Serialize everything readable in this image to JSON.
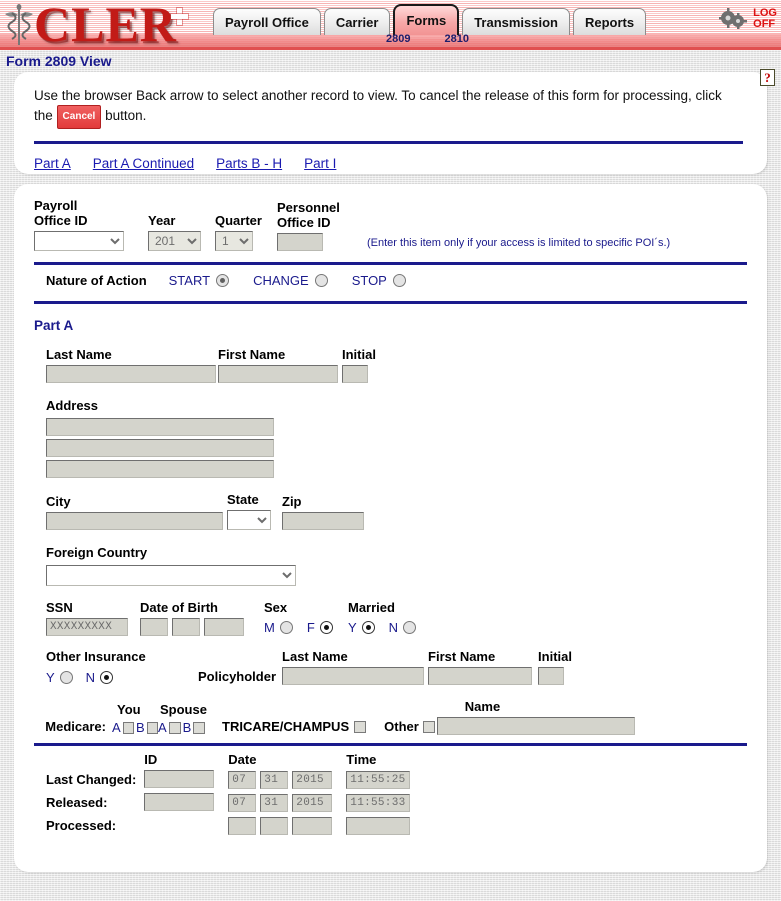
{
  "banner": {
    "logo_text": "CLER",
    "caduceus_icon": "caduceus-icon",
    "tabs": [
      {
        "label": "Payroll Office",
        "active": false
      },
      {
        "label": "Carrier",
        "active": false
      },
      {
        "label": "Forms",
        "active": true
      },
      {
        "label": "Transmission",
        "active": false
      },
      {
        "label": "Reports",
        "active": false
      }
    ],
    "subtabs": [
      {
        "label": "2809"
      },
      {
        "label": "2810"
      }
    ],
    "gears_icon": "gears-icon",
    "logoff_line1": "LOG",
    "logoff_line2": "OFF"
  },
  "page_title": "Form 2809 View",
  "instructions": {
    "help_icon": "help-question-icon",
    "text_before": "Use the browser Back arrow to select another record to view.  To cancel the release of this form for processing, click the",
    "cancel_label": "Cancel",
    "text_after": "button.",
    "part_links": [
      {
        "label": "Part A"
      },
      {
        "label": "Part A Continued"
      },
      {
        "label": "Parts B - H"
      },
      {
        "label": "Part I"
      }
    ]
  },
  "form": {
    "payroll_office_id": {
      "label_line1": "Payroll",
      "label_line2": "Office ID",
      "value": ""
    },
    "year": {
      "label": "Year",
      "value": "201"
    },
    "quarter": {
      "label": "Quarter",
      "value": "1"
    },
    "personnel_office_id": {
      "label_line1": "Personnel",
      "label_line2": "Office ID",
      "value": ""
    },
    "poi_note": "(Enter this item only if your access is limited to specific POI´s.)",
    "nature_of_action": {
      "label": "Nature of Action",
      "options": [
        {
          "label": "START",
          "selected": true
        },
        {
          "label": "CHANGE",
          "selected": false
        },
        {
          "label": "STOP",
          "selected": false
        }
      ]
    },
    "part_a_heading": "Part A",
    "name": {
      "last_label": "Last Name",
      "last_value": "",
      "first_label": "First Name",
      "first_value": "",
      "initial_label": "Initial",
      "initial_value": ""
    },
    "address": {
      "label": "Address",
      "line1": "",
      "line2": "",
      "line3": ""
    },
    "city": {
      "label": "City",
      "value": ""
    },
    "state": {
      "label": "State",
      "value": ""
    },
    "zip": {
      "label": "Zip",
      "value": ""
    },
    "foreign_country": {
      "label": "Foreign Country",
      "value": ""
    },
    "ssn": {
      "label": "SSN",
      "value": "XXXXXXXXX"
    },
    "dob": {
      "label": "Date of Birth",
      "month": "",
      "day": "",
      "year": ""
    },
    "sex": {
      "label": "Sex",
      "options": [
        {
          "label": "M",
          "selected": false
        },
        {
          "label": "F",
          "selected": true
        }
      ]
    },
    "married": {
      "label": "Married",
      "options": [
        {
          "label": "Y",
          "selected": true
        },
        {
          "label": "N",
          "selected": false
        }
      ]
    },
    "other_insurance": {
      "label": "Other Insurance",
      "options": [
        {
          "label": "Y",
          "selected": false
        },
        {
          "label": "N",
          "selected": true
        }
      ],
      "policyholder_label": "Policyholder",
      "last_label": "Last Name",
      "last_value": "",
      "first_label": "First Name",
      "first_value": "",
      "initial_label": "Initial",
      "initial_value": ""
    },
    "medicare": {
      "label": "Medicare:",
      "you_label": "You",
      "spouse_label": "Spouse",
      "you_a_label": "A",
      "you_a_checked": false,
      "you_b_label": "B",
      "you_b_checked": false,
      "spouse_a_label": "A",
      "spouse_a_checked": false,
      "spouse_b_label": "B",
      "spouse_b_checked": false,
      "tricare_label": "TRICARE/CHAMPUS",
      "tricare_checked": false,
      "other_label": "Other",
      "other_checked": false,
      "name_label": "Name",
      "name_value": ""
    },
    "audit": {
      "id_header": "ID",
      "date_header": "Date",
      "time_header": "Time",
      "rows": [
        {
          "label": "Last Changed:",
          "id": "",
          "month": "07",
          "day": "31",
          "year": "2015",
          "time": "11:55:25",
          "show_id": true
        },
        {
          "label": "Released:",
          "id": "",
          "month": "07",
          "day": "31",
          "year": "2015",
          "time": "11:55:33",
          "show_id": true
        },
        {
          "label": "Processed:",
          "id": "",
          "month": "",
          "day": "",
          "year": "",
          "time": "",
          "show_id": false
        }
      ]
    }
  }
}
